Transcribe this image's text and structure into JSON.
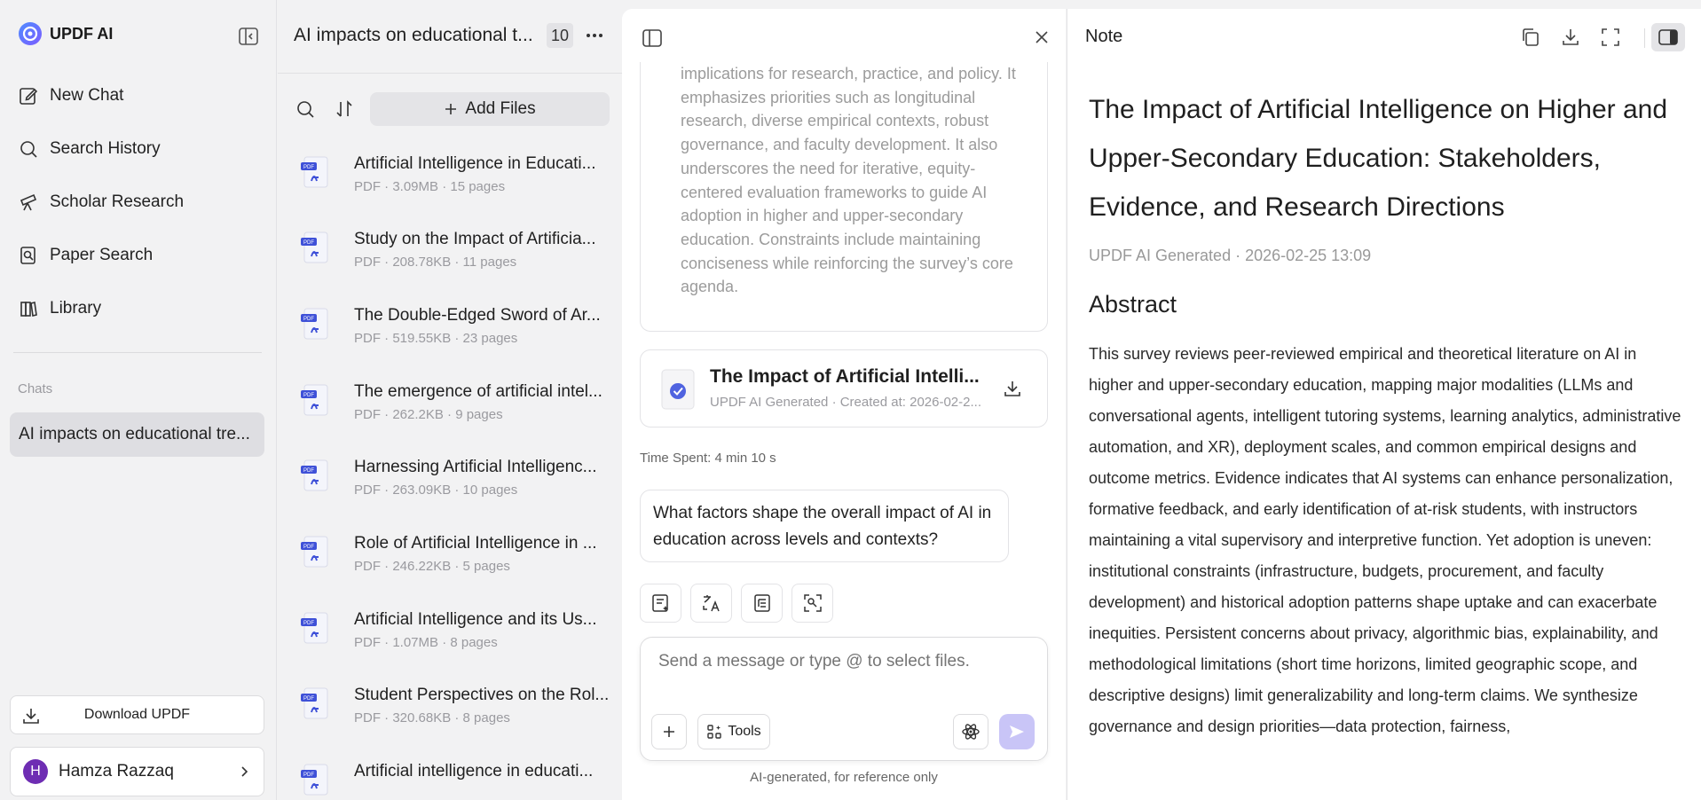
{
  "app": {
    "name": "UPDF AI"
  },
  "sidebar": {
    "items": [
      {
        "label": "New Chat",
        "icon": "edit-icon"
      },
      {
        "label": "Search History",
        "icon": "search-icon"
      },
      {
        "label": "Scholar Research",
        "icon": "telescope-icon"
      },
      {
        "label": "Paper Search",
        "icon": "document-search-icon"
      },
      {
        "label": "Library",
        "icon": "library-icon"
      }
    ],
    "chats_heading": "Chats",
    "active_chat": "AI impacts on educational tre...",
    "download_label": "Download UPDF",
    "user": {
      "initial": "H",
      "name": "Hamza Razzaq"
    }
  },
  "files": {
    "title": "AI impacts on educational t...",
    "count": "10",
    "add_label": "Add Files",
    "list": [
      {
        "name": "Artificial Intelligence in Educati...",
        "meta": "PDF · 3.09MB · 15 pages"
      },
      {
        "name": "Study on the Impact of Artificia...",
        "meta": "PDF · 208.78KB · 11 pages"
      },
      {
        "name": "The Double-Edged Sword of Ar...",
        "meta": "PDF · 519.55KB · 23 pages"
      },
      {
        "name": "The emergence of artificial intel...",
        "meta": "PDF · 262.2KB · 9 pages"
      },
      {
        "name": "Harnessing Artificial Intelligenc...",
        "meta": "PDF · 263.09KB · 10 pages"
      },
      {
        "name": "Role of Artificial Intelligence in ...",
        "meta": "PDF · 246.22KB · 5 pages"
      },
      {
        "name": "Artificial Intelligence and its Us...",
        "meta": "PDF · 1.07MB · 8 pages"
      },
      {
        "name": "Student Perspectives on the Rol...",
        "meta": "PDF · 320.68KB · 8 pages"
      },
      {
        "name": "Artificial intelligence in educati...",
        "meta": ""
      }
    ]
  },
  "chat": {
    "answer_text": "implications for research, practice, and policy. It emphasizes priorities such as longitudinal research, diverse empirical contexts, robust governance, and faculty development. It also underscores the need for iterative, equity-centered evaluation frameworks to guide AI adoption in higher and upper-secondary education. Constraints include maintaining conciseness while reinforcing the survey’s core agenda.",
    "doc_card": {
      "title": "The Impact of Artificial Intelli...",
      "meta": "UPDF AI Generated · Created at: 2026-02-2..."
    },
    "time_spent": "Time Spent: 4 min 10 s",
    "user_message": "What factors shape the overall impact of AI in education across levels and contexts?",
    "input_placeholder": "Send a message or type @ to select files.",
    "tools_label": "Tools",
    "disclaimer": "AI-generated, for reference only",
    "accent": "#c9c5f7"
  },
  "note": {
    "header": "Note",
    "title": "The Impact of Artificial Intelligence on Higher and Upper-Secondary Education: Stakeholders, Evidence, and Research Directions",
    "subtitle": "UPDF AI Generated · 2026-02-25 13:09",
    "section": "Abstract",
    "body": "This survey reviews peer-reviewed empirical and theoretical literature on AI in higher and upper-secondary education, mapping major modalities (LLMs and conversational agents, intelligent tutoring systems, learning analytics, administrative automation, and XR), deployment scales, and common empirical designs and outcome metrics. Evidence indicates that AI systems can enhance personalization, formative feedback, and early identification of at-risk students, with instructors maintaining a vital supervisory and interpretive function. Yet adoption is uneven: institutional constraints (infrastructure, budgets, procurement, and faculty development) and historical adoption patterns shape uptake and can exacerbate inequities. Persistent concerns about privacy, algorithmic bias, explainability, and methodological limitations (short time horizons, limited geographic scope, and descriptive designs) limit generalizability and long-term claims. We synthesize governance and design priorities—data protection, fairness,"
  }
}
